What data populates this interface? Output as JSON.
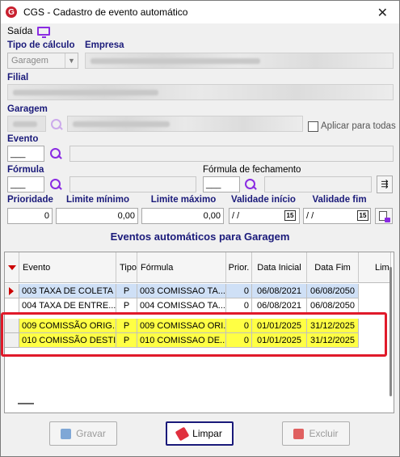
{
  "window": {
    "title": "CGS - Cadastro de evento automático",
    "close_glyph": "✕",
    "app_icon_letter": "G"
  },
  "menu": {
    "saida": "Saída"
  },
  "form": {
    "tipo_calculo_label": "Tipo de cálculo",
    "tipo_calculo_value": "Garagem",
    "empresa_label": "Empresa",
    "filial_label": "Filial",
    "garagem_label": "Garagem",
    "aplicar_todas_label": "Aplicar para todas",
    "evento_label": "Evento",
    "evento_value": "___",
    "formula_label": "Fórmula",
    "formula_value": "___",
    "formula_fechamento_label": "Fórmula de fechamento",
    "formula_fechamento_value": "___",
    "prioridade_label": "Prioridade",
    "prioridade_value": "0",
    "limite_minimo_label": "Limite mínimo",
    "limite_minimo_value": "0,00",
    "limite_maximo_label": "Limite máximo",
    "limite_maximo_value": "0,00",
    "validade_inicio_label": "Validade início",
    "validade_inicio_value": "/ /",
    "validade_fim_label": "Validade fim",
    "validade_fim_value": "/ /",
    "calendar_glyph": "15"
  },
  "grid": {
    "title": "Eventos automáticos para Garagem",
    "columns": {
      "evento": "Evento",
      "tipo": "Tipo",
      "formula": "Fórmula",
      "prior": "Prior.",
      "data_inicial": "Data Inicial",
      "data_fim": "Data Fim",
      "lim": "Lim"
    },
    "rows": [
      {
        "evento": "003 TAXA DE COLETA",
        "tipo": "P",
        "formula": "003 COMISSAO TA...",
        "prior": "0",
        "data_inicial": "06/08/2021",
        "data_fim": "06/08/2050"
      },
      {
        "evento": "004 TAXA DE ENTRE...",
        "tipo": "P",
        "formula": "004 COMISSAO TA...",
        "prior": "0",
        "data_inicial": "06/08/2021",
        "data_fim": "06/08/2050"
      },
      {
        "evento": "009 COMISSÃO ORIG...",
        "tipo": "P",
        "formula": "009 COMISSAO ORI...",
        "prior": "0",
        "data_inicial": "01/01/2025",
        "data_fim": "31/12/2025"
      },
      {
        "evento": "010 COMISSÃO DESTI...",
        "tipo": "P",
        "formula": "010 COMISSAO DE...",
        "prior": "0",
        "data_inicial": "01/01/2025",
        "data_fim": "31/12/2025"
      }
    ]
  },
  "buttons": {
    "gravar": "Gravar",
    "limpar": "Limpar",
    "excluir": "Excluir"
  },
  "colors": {
    "label_blue": "#1a1a7a",
    "accent_purple": "#8a2be2",
    "highlight_red": "#e01a2a",
    "row_yellow": "#ffff44",
    "row_selected": "#cfe0f6"
  }
}
